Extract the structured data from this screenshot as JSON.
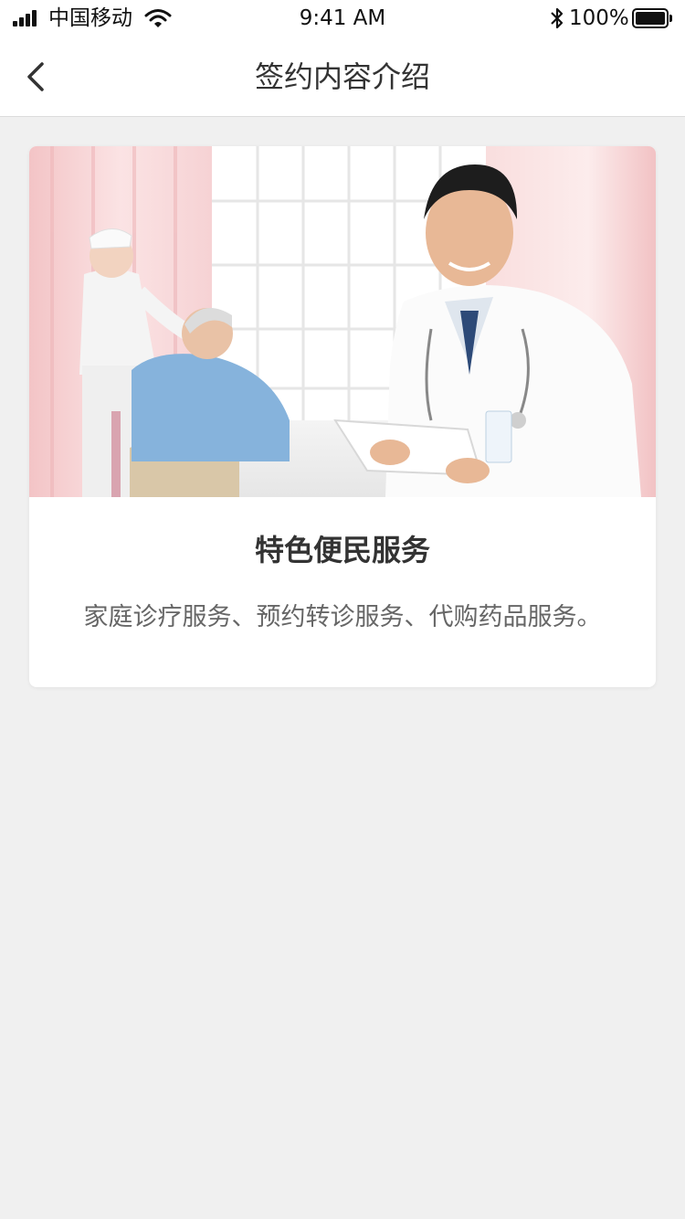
{
  "status_bar": {
    "carrier": "中国移动",
    "time": "9:41 AM",
    "battery": "100%",
    "signal_icon": "signal-bars-icon",
    "wifi_icon": "wifi-icon",
    "bluetooth_icon": "bluetooth-icon",
    "battery_icon": "battery-icon"
  },
  "nav": {
    "title": "签约内容介绍",
    "back_icon": "chevron-left-icon"
  },
  "card": {
    "image": "doctor-nurse-patient-photo",
    "title": "特色便民服务",
    "description": "家庭诊疗服务、预约转诊服务、代购药品服务。"
  },
  "colors": {
    "background": "#f0f0f0",
    "surface": "#ffffff",
    "text_primary": "#333333",
    "text_secondary": "#666666"
  }
}
